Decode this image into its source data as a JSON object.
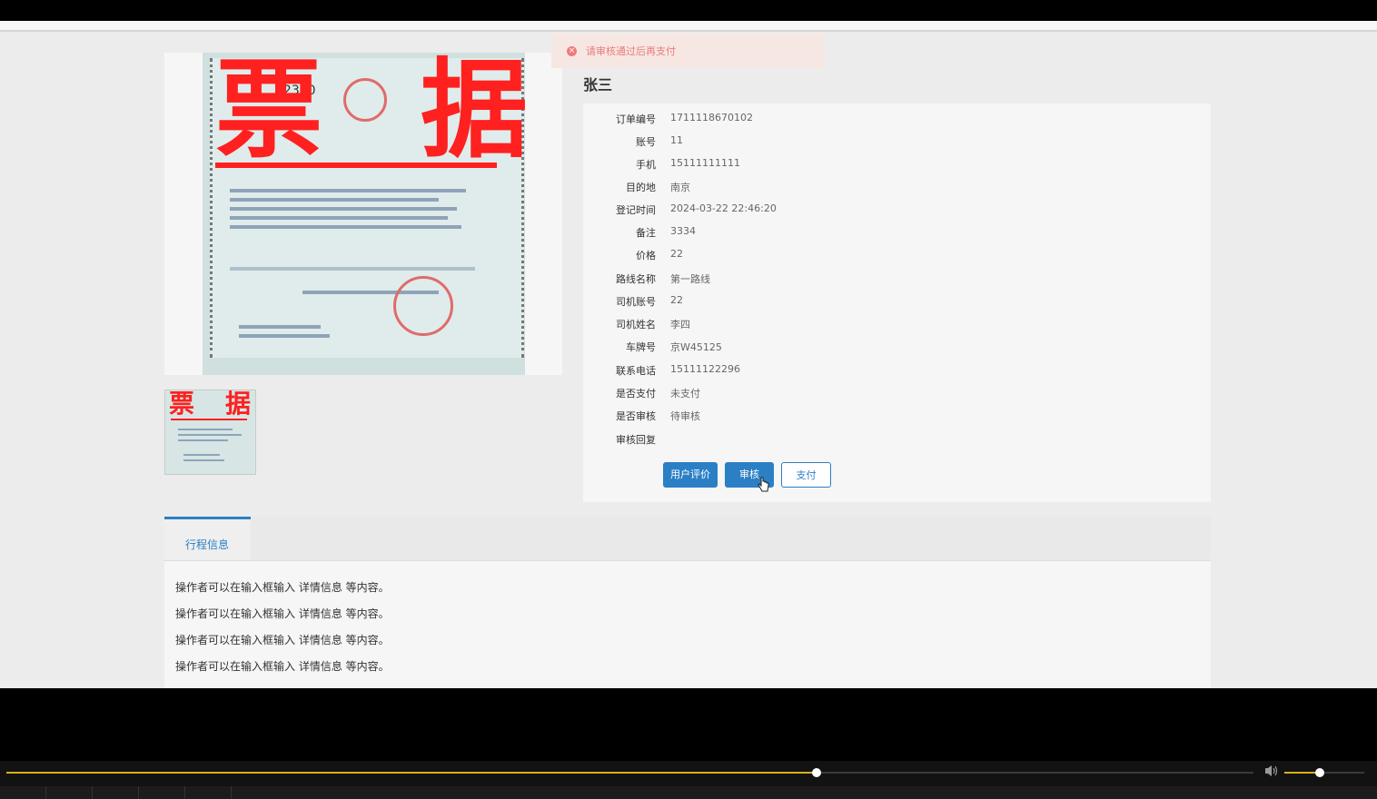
{
  "toast": {
    "message": "请审核通过后再支付",
    "icon": "error-circle-icon",
    "color": "#ea7b7b"
  },
  "gallery": {
    "main_image": {
      "stamp_text_left": "票",
      "stamp_text_right": "据",
      "receipt_number": "62320"
    },
    "thumbnail": {
      "stamp_text_left": "票",
      "stamp_text_right": "据"
    }
  },
  "detail": {
    "name": "张三",
    "fields": [
      {
        "label": "订单编号",
        "value": "1711118670102"
      },
      {
        "label": "账号",
        "value": "11"
      },
      {
        "label": "手机",
        "value": "15111111111"
      },
      {
        "label": "目的地",
        "value": "南京"
      },
      {
        "label": "登记时间",
        "value": "2024-03-22 22:46:20"
      },
      {
        "label": "备注",
        "value": "3334"
      },
      {
        "label": "价格",
        "value": "22"
      },
      {
        "label": "路线名称",
        "value": "第一路线"
      },
      {
        "label": "司机账号",
        "value": "22"
      },
      {
        "label": "司机姓名",
        "value": "李四"
      },
      {
        "label": "车牌号",
        "value": "京W45125"
      },
      {
        "label": "联系电话",
        "value": "15111122296"
      },
      {
        "label": "是否支付",
        "value": "未支付"
      },
      {
        "label": "是否审核",
        "value": "待审核"
      },
      {
        "label": "审核回复",
        "value": ""
      }
    ],
    "buttons": {
      "review": "用户评价",
      "audit": "审核",
      "pay": "支付"
    },
    "accent_color": "#2b7fc5"
  },
  "tabs": {
    "items": [
      {
        "label": "行程信息",
        "active": true
      }
    ],
    "content_lines": [
      "操作者可以在输入框输入  详情信息  等内容。",
      "操作者可以在输入框输入  详情信息  等内容。",
      "操作者可以在输入框输入  详情信息  等内容。",
      "操作者可以在输入框输入  详情信息  等内容。"
    ]
  },
  "player": {
    "progress_fraction": 0.65,
    "volume_fraction": 0.44,
    "progress_color": "#d7b21b",
    "volume_icon": "speaker-icon"
  }
}
